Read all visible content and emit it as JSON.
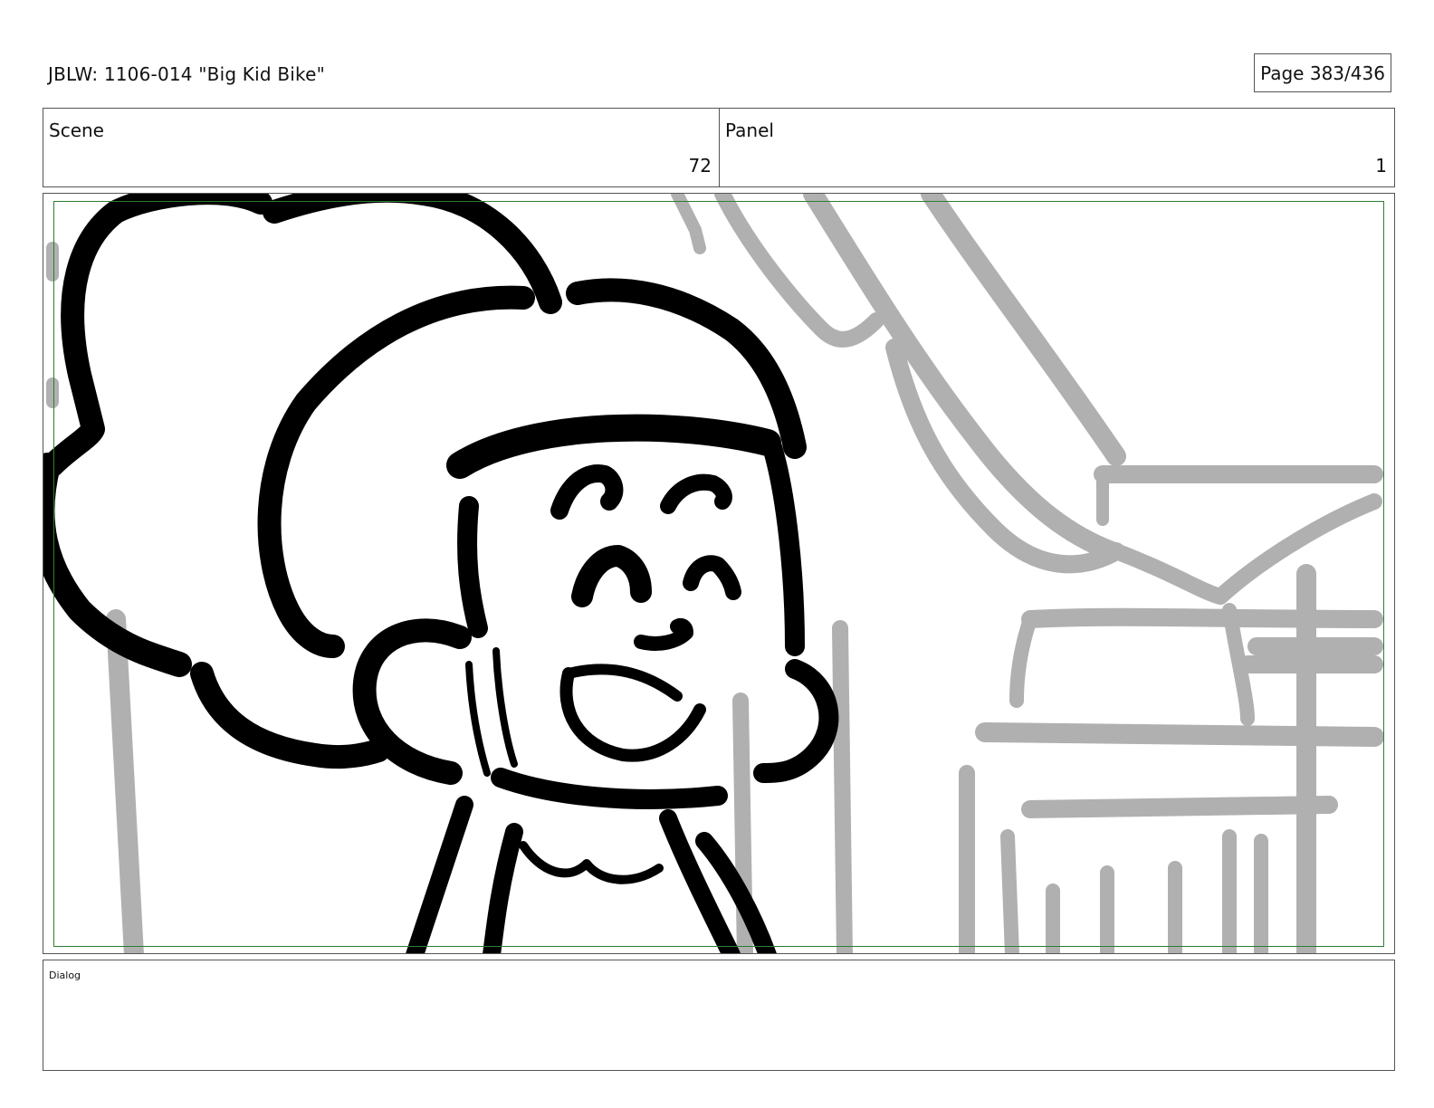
{
  "document": {
    "title": "JBLW: 1106-014 \"Big Kid Bike\"",
    "page": "Page 383/436"
  },
  "header": {
    "scene_label": "Scene",
    "scene_value": "72",
    "panel_label": "Panel",
    "panel_value": "1"
  },
  "dialog": {
    "label": "Dialog",
    "text": ""
  },
  "colors": {
    "safe_frame": "#2e7d32",
    "ink": "#000000",
    "background_sketch": "#b0b0b0"
  }
}
